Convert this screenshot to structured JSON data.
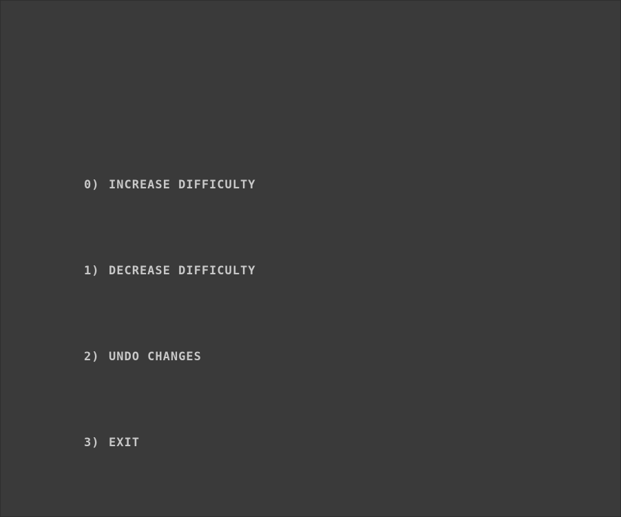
{
  "menu": {
    "items": [
      {
        "number": "0)",
        "label": "INCREASE DIFFICULTY"
      },
      {
        "number": "1)",
        "label": "DECREASE DIFFICULTY"
      },
      {
        "number": "2)",
        "label": "UNDO CHANGES"
      },
      {
        "number": "3)",
        "label": "EXIT"
      }
    ]
  },
  "colors": {
    "background": "#3a3a3a",
    "text": "#c8c8c8"
  }
}
